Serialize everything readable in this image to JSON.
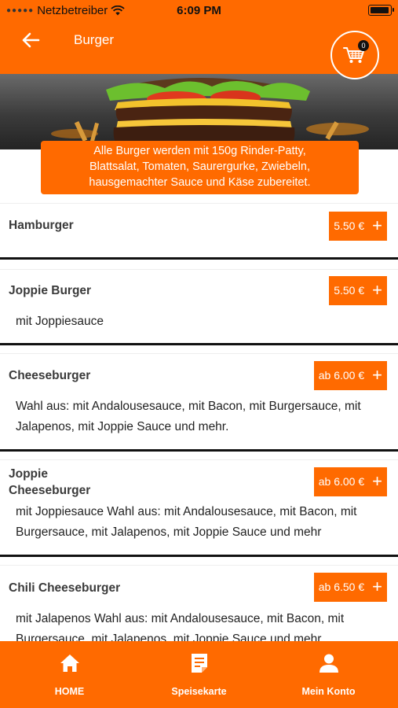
{
  "status_bar": {
    "carrier": "Netzbetreiber",
    "time": "6:09 PM"
  },
  "header": {
    "title": "Burger",
    "cart_count": "0"
  },
  "banner": {
    "lines": [
      "Alle Burger werden mit 150g Rinder-Patty,",
      "Blattsalat, Tomaten, Saurergurke, Zwiebeln,",
      "hausgemachter Sauce und Käse zubereitet."
    ]
  },
  "items": [
    {
      "name": "Hamburger",
      "price": "5.50 €",
      "desc_lines": []
    },
    {
      "name": "Joppie Burger",
      "price": "5.50 €",
      "desc_lines": [
        "mit Joppiesauce"
      ]
    },
    {
      "name": "Cheeseburger",
      "price": "ab 6.00 €",
      "desc_lines": [
        "Wahl aus: mit Andalousesauce, mit Bacon, mit Burgersauce, mit",
        "Jalapenos, mit Joppie Sauce und mehr."
      ]
    },
    {
      "name_lines": [
        "Joppie",
        "Cheeseburger"
      ],
      "price": "ab 6.00 €",
      "desc_lines": [
        "mit Joppiesauce Wahl aus: mit Andalousesauce, mit Bacon, mit",
        "Burgersauce, mit Jalapenos, mit Joppie Sauce und mehr"
      ]
    },
    {
      "name": "Chili Cheeseburger",
      "price": "ab 6.50 €",
      "desc_lines": [
        "mit Jalapenos Wahl aus: mit Andalousesauce, mit Bacon, mit",
        "Burgersauce, mit Jalapenos, mit Joppie Sauce und mehr"
      ]
    }
  ],
  "tabs": [
    {
      "label": "HOME",
      "icon": "home-icon"
    },
    {
      "label": "Speisekarte",
      "icon": "menu-card-icon"
    },
    {
      "label": "Mein Konto",
      "icon": "account-icon"
    }
  ],
  "colors": {
    "accent": "#ff6a00",
    "divider": "#111111"
  }
}
